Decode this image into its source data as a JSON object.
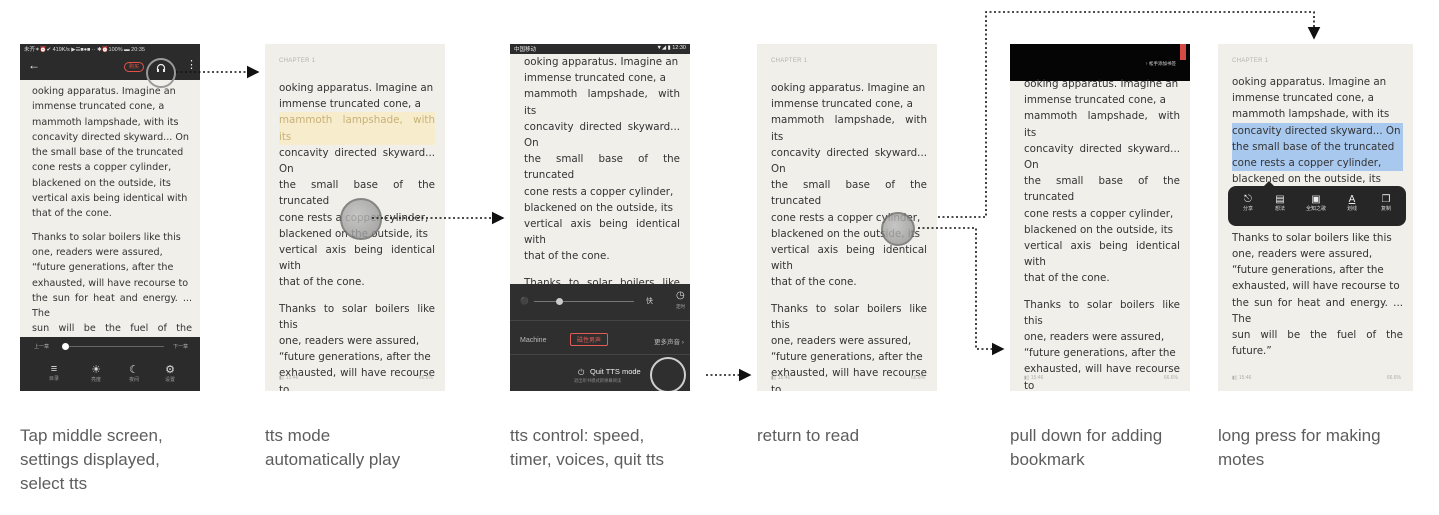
{
  "captions": [
    "Tap middle screen,\nsettings displayed,\nselect tts",
    "tts mode\nautomatically play",
    "tts control: speed,\ntimer, voices, quit tts",
    "return to read",
    "pull down for adding\nbookmark",
    "long press for making\nmotes"
  ],
  "reader": {
    "chapter": "CHAPTER 1",
    "para1_lines": [
      "ooking apparatus. Imagine an",
      "immense truncated cone, a",
      "mammoth lampshade, with its",
      "concavity directed skyward... On",
      "the small base of the truncated",
      "cone rests a copper cylinder,",
      "blackened on the outside, its",
      "vertical axis being identical with",
      "that of the cone."
    ],
    "para2_lines": [
      "Thanks to solar boilers like this",
      "one, readers were assured,",
      "“future generations, after the",
      "exhausted, will have recourse to",
      "the sun for heat and energy. ... The",
      "sun will be the fuel of the future.”"
    ],
    "footer_left": "▮▯ 15:46",
    "footer_right": "66.6%"
  },
  "screen1": {
    "status_bar": "未齐✶⏰✔ 419K/s ▶☰■●■ ··  ✱⏰100% ▬ 20:35",
    "back_icon": "←",
    "buy_label": "购买",
    "more_icon": "⋮",
    "prev_chapter": "上一章",
    "next_chapter": "下一章",
    "menu": [
      {
        "icon": "≡",
        "label": "目录"
      },
      {
        "icon": "☀",
        "label": "亮度"
      },
      {
        "icon": "☾",
        "label": "夜间"
      },
      {
        "icon": "⚙",
        "label": "设置"
      }
    ]
  },
  "screen3": {
    "status_left": "中国移动",
    "status_right": "▼◢ ▮ 12:30",
    "speed_label": "快",
    "timer_label": "定时",
    "voice_label": "Machine",
    "voice_selected": "磁性男声",
    "more_voices": "更多声音 ›",
    "quit_label": "Quit TTS mode",
    "quit_sub": "退出听书模式即换幕阅读"
  },
  "screen5": {
    "bookmark_hint": "↑ 松手添加书签"
  },
  "screen6": {
    "menu": [
      {
        "icon": "⎋",
        "label": "分享"
      },
      {
        "icon": "▤",
        "label": "想法"
      },
      {
        "icon": "▣",
        "label": "全知之歌"
      },
      {
        "icon": "A",
        "label": "划线"
      },
      {
        "icon": "❐",
        "label": "复制"
      }
    ]
  }
}
